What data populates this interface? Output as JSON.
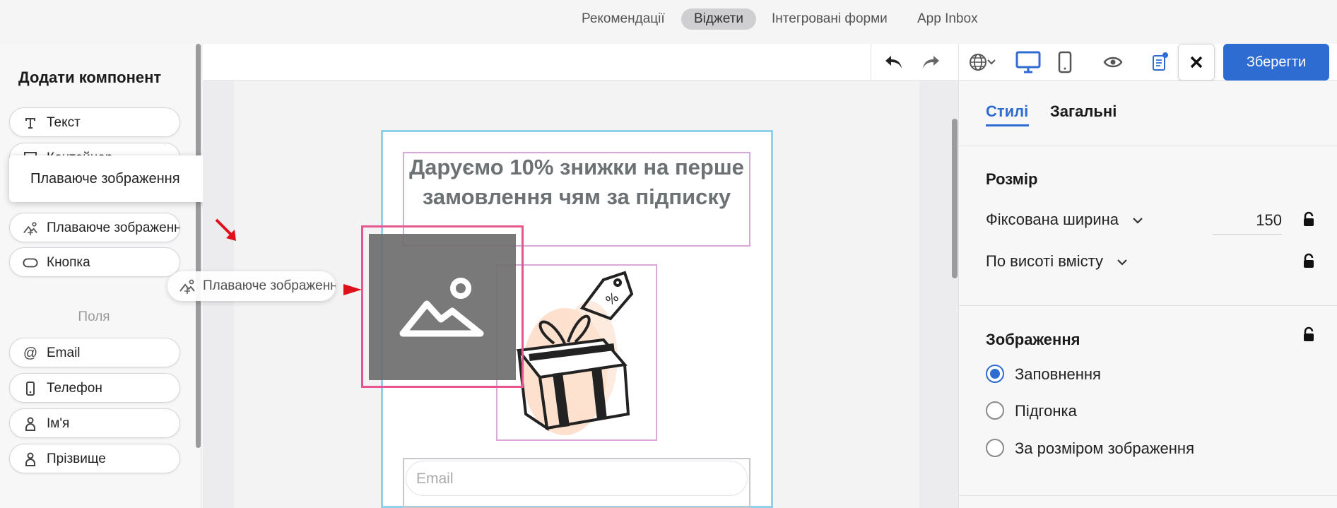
{
  "topnav": {
    "tabs": [
      {
        "label": "Рекомендації"
      },
      {
        "label": "Віджети",
        "active": true
      },
      {
        "label": "Інтегровані форми"
      },
      {
        "label": "App Inbox"
      }
    ]
  },
  "left_panel": {
    "title": "Додати компонент",
    "components": [
      {
        "label": "Текст",
        "icon": "text-icon"
      },
      {
        "label": "Контейнер",
        "icon": "container-icon"
      },
      {
        "label": "Плаваюче зображення",
        "icon": "floating-image-icon"
      },
      {
        "label": "Кнопка",
        "icon": "button-shape-icon"
      }
    ],
    "fields_title": "Поля",
    "fields": [
      {
        "label": "Email",
        "icon": "at-icon"
      },
      {
        "label": "Телефон",
        "icon": "phone-icon"
      },
      {
        "label": "Ім'я",
        "icon": "person-icon"
      },
      {
        "label": "Прізвище",
        "icon": "person-icon"
      }
    ],
    "tooltip": "Плаваюче зображення",
    "drag_chip": "Плаваюче зображення"
  },
  "toolbar": {
    "icons": [
      "undo-icon",
      "redo-icon",
      "globe-icon",
      "desktop-icon",
      "mobile-icon",
      "eye-icon",
      "notes-icon",
      "close-icon"
    ],
    "save_label": "Зберегти"
  },
  "canvas": {
    "headline": "Даруємо 10% знижки на перше замовлення чям за підписку",
    "email_placeholder": "Email"
  },
  "right_panel": {
    "tabs": [
      {
        "label": "Стилі",
        "active": true
      },
      {
        "label": "Загальні"
      }
    ],
    "size_section": {
      "title": "Розмір",
      "width_mode": "Фіксована ширина",
      "width_value": "150",
      "height_mode": "По висоті вмісту"
    },
    "image_section": {
      "title": "Зображення",
      "options": [
        {
          "label": "Заповнення",
          "checked": true
        },
        {
          "label": "Підгонка",
          "checked": false
        },
        {
          "label": "За розміром зображення",
          "checked": false
        }
      ]
    }
  },
  "colors": {
    "accent": "#2f6cd2",
    "selection_pink": "#e6578f",
    "widget_border": "#8fd0ea",
    "arrow_red": "#e0101a"
  }
}
